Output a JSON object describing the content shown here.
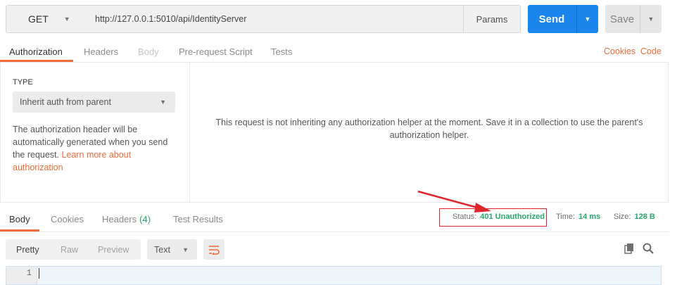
{
  "request": {
    "method": "GET",
    "url": "http://127.0.0.1:5010/api/IdentityServer",
    "params_label": "Params",
    "send_label": "Send",
    "save_label": "Save"
  },
  "request_tabs": [
    {
      "label": "Authorization",
      "state": "active"
    },
    {
      "label": "Headers",
      "state": "normal"
    },
    {
      "label": "Body",
      "state": "disabled"
    },
    {
      "label": "Pre-request Script",
      "state": "normal"
    },
    {
      "label": "Tests",
      "state": "normal"
    }
  ],
  "top_links": {
    "cookies": "Cookies",
    "code": "Code"
  },
  "auth": {
    "type_label": "TYPE",
    "type_value": "Inherit auth from parent",
    "description": "The authorization header will be automatically generated when you send the request.",
    "learn_more": "Learn more about authorization",
    "message": "This request is not inheriting any authorization helper at the moment. Save it in a collection to use the parent's authorization helper."
  },
  "response_tabs": [
    {
      "label": "Body",
      "state": "active"
    },
    {
      "label": "Cookies",
      "state": "normal"
    },
    {
      "label": "Headers",
      "count": "(4)",
      "state": "normal"
    },
    {
      "label": "Test Results",
      "state": "normal"
    }
  ],
  "response_meta": {
    "status_label": "Status:",
    "status_value": "401 Unauthorized",
    "time_label": "Time:",
    "time_value": "14 ms",
    "size_label": "Size:",
    "size_value": "128 B"
  },
  "viewer": {
    "formats": [
      "Pretty",
      "Raw",
      "Preview"
    ],
    "active_format": "Pretty",
    "type_value": "Text",
    "line_numbers": [
      "1"
    ]
  },
  "colors": {
    "accent": "#f26b3a",
    "send": "#1a85ec",
    "status_ok_text": "#26a86b",
    "annotation": "#e0252b"
  }
}
